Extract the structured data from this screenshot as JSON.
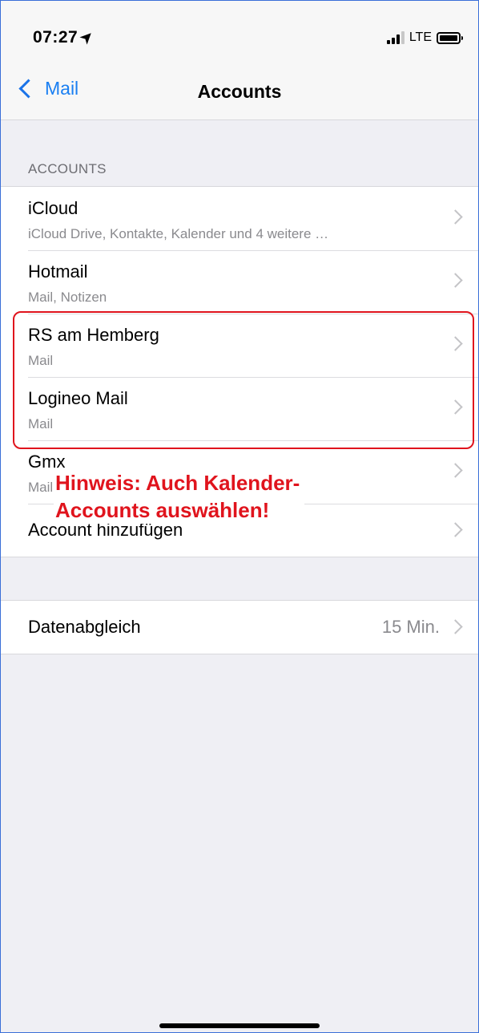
{
  "status_bar": {
    "time": "07:27",
    "location_icon": "location-arrow-icon",
    "network": "LTE",
    "signal_bars_active": 3,
    "signal_bars_total": 4
  },
  "nav": {
    "back_label": "Mail",
    "title": "Accounts"
  },
  "accounts_section": {
    "header": "ACCOUNTS",
    "items": [
      {
        "title": "iCloud",
        "subtitle": "iCloud Drive, Kontakte, Kalender und 4 weitere …"
      },
      {
        "title": "Hotmail",
        "subtitle": "Mail, Notizen"
      },
      {
        "title": "RS am Hemberg",
        "subtitle": "Mail"
      },
      {
        "title": "Logineo Mail",
        "subtitle": "Mail"
      },
      {
        "title": "Gmx",
        "subtitle": "Mail"
      }
    ],
    "add_account": "Account hinzufügen"
  },
  "sync": {
    "label": "Datenabgleich",
    "value": "15 Min."
  },
  "annotation": {
    "line1": "Hinweis: Auch Kalender-",
    "line2": "Accounts auswählen!",
    "color": "#e0141d"
  },
  "colors": {
    "accent": "#1a7ff2",
    "background": "#efeff4"
  }
}
